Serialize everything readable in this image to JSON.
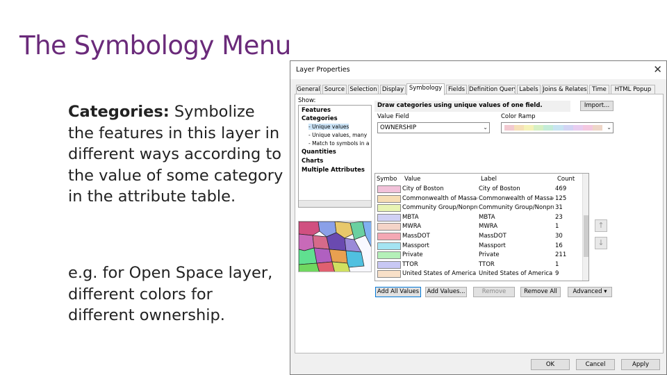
{
  "slide": {
    "title": "The Symbology Menu",
    "para1_bold": "Categories:",
    "para1_text": " Symbolize the features in this layer in different ways according to the value of some category in the attribute table.",
    "para2_text": "e.g. for Open Space layer, different colors for different ownership."
  },
  "dialog": {
    "title": "Layer Properties",
    "close_icon": "close-icon",
    "tabs": [
      "General",
      "Source",
      "Selection",
      "Display",
      "Symbology",
      "Fields",
      "Definition Query",
      "Labels",
      "Joins & Relates",
      "Time",
      "HTML Popup"
    ],
    "active_tab": "Symbology",
    "show_label": "Show:",
    "show_tree": [
      {
        "label": "Features",
        "bold": true
      },
      {
        "label": "Categories",
        "bold": true
      },
      {
        "label": "- Unique values",
        "bold": false
      },
      {
        "label": "- Unique values, many",
        "bold": false
      },
      {
        "label": "- Match to symbols in a",
        "bold": false
      },
      {
        "label": "Quantities",
        "bold": true
      },
      {
        "label": "Charts",
        "bold": true
      },
      {
        "label": "Multiple Attributes",
        "bold": true
      }
    ],
    "description": "Draw categories using unique values of one field.",
    "import_button": "Import...",
    "value_field_label": "Value Field",
    "value_field": "OWNERSHIP",
    "color_ramp_label": "Color Ramp",
    "ramp_colors": [
      "#f2c9d0",
      "#f6e0b8",
      "#f5f2b8",
      "#d6f0c4",
      "#c4ecd8",
      "#c8e4f2",
      "#d2d4f4",
      "#e8cdf0",
      "#f4c8e0",
      "#eed6c8"
    ],
    "grid_headers": {
      "symbol": "Symbo",
      "value": "Value",
      "label": "Label",
      "count": "Count"
    },
    "rows": [
      {
        "value": "City of Boston",
        "label": "City of Boston",
        "count": "469",
        "color": "#f2c2da"
      },
      {
        "value": "Commonwealth of Massach...",
        "label": "Commonwealth of Massachu...",
        "count": "125",
        "color": "#f6ddb4"
      },
      {
        "value": "Community Group/Nonprofit",
        "label": "Community Group/Nonprofi...",
        "count": "31",
        "color": "#e8f4b4"
      },
      {
        "value": "MBTA",
        "label": "MBTA",
        "count": "23",
        "color": "#d0d0f4"
      },
      {
        "value": "MWRA",
        "label": "MWRA",
        "count": "1",
        "color": "#f4d4c8"
      },
      {
        "value": "MassDOT",
        "label": "MassDOT",
        "count": "30",
        "color": "#f4a8b4"
      },
      {
        "value": "Massport",
        "label": "Massport",
        "count": "16",
        "color": "#a4e4f2"
      },
      {
        "value": "Private",
        "label": "Private",
        "count": "211",
        "color": "#b4f0b8"
      },
      {
        "value": "TTOR",
        "label": "TTOR",
        "count": "1",
        "color": "#c8c8f4"
      },
      {
        "value": "United States of America",
        "label": "United States of America",
        "count": "9",
        "color": "#f8e0c8"
      }
    ],
    "buttons": {
      "add_all_values": "Add All Values",
      "add_values": "Add Values...",
      "remove": "Remove",
      "remove_all": "Remove All",
      "advanced": "Advanced"
    },
    "footer": {
      "ok": "OK",
      "cancel": "Cancel",
      "apply": "Apply"
    }
  }
}
